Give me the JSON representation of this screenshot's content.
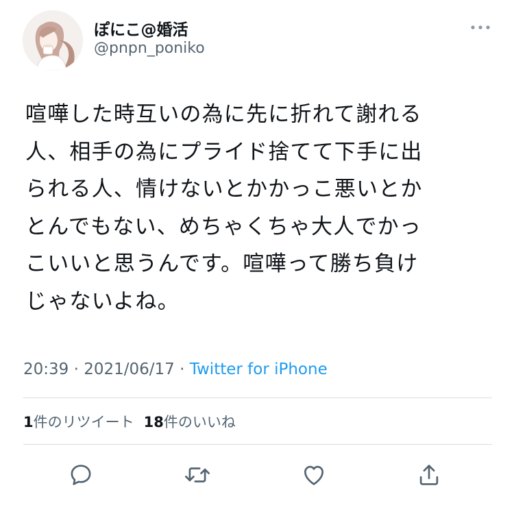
{
  "user": {
    "display_name": "ぽにこ@婚活",
    "handle": "@pnpn_poniko",
    "avatar_icon": "user-avatar-illustration"
  },
  "tweet": {
    "lines": [
      "喧嘩した時互いの為に先に折れて謝れる",
      "人、相手の為にプライド捨てて下手に出",
      "られる人、情けないとかかっこ悪いとか",
      "とんでもない、めちゃくちゃ大人でかっ",
      "こいいと思うんです。喧嘩って勝ち負け",
      "じゃないよね。"
    ]
  },
  "meta": {
    "time": "20:39",
    "separator": " · ",
    "date": "2021/06/17",
    "source": "Twitter for iPhone"
  },
  "stats": {
    "retweet_count": "1",
    "retweet_label": "件のリツイート",
    "like_count": "18",
    "like_label": "件のいいね"
  },
  "actions": {
    "reply_icon": "reply-icon",
    "retweet_icon": "retweet-icon",
    "like_icon": "heart-icon",
    "share_icon": "share-icon"
  },
  "colors": {
    "text": "#0f1419",
    "secondary": "#536471",
    "link": "#1d9bf0",
    "divider": "#d9dde1",
    "icon": "#536471"
  }
}
